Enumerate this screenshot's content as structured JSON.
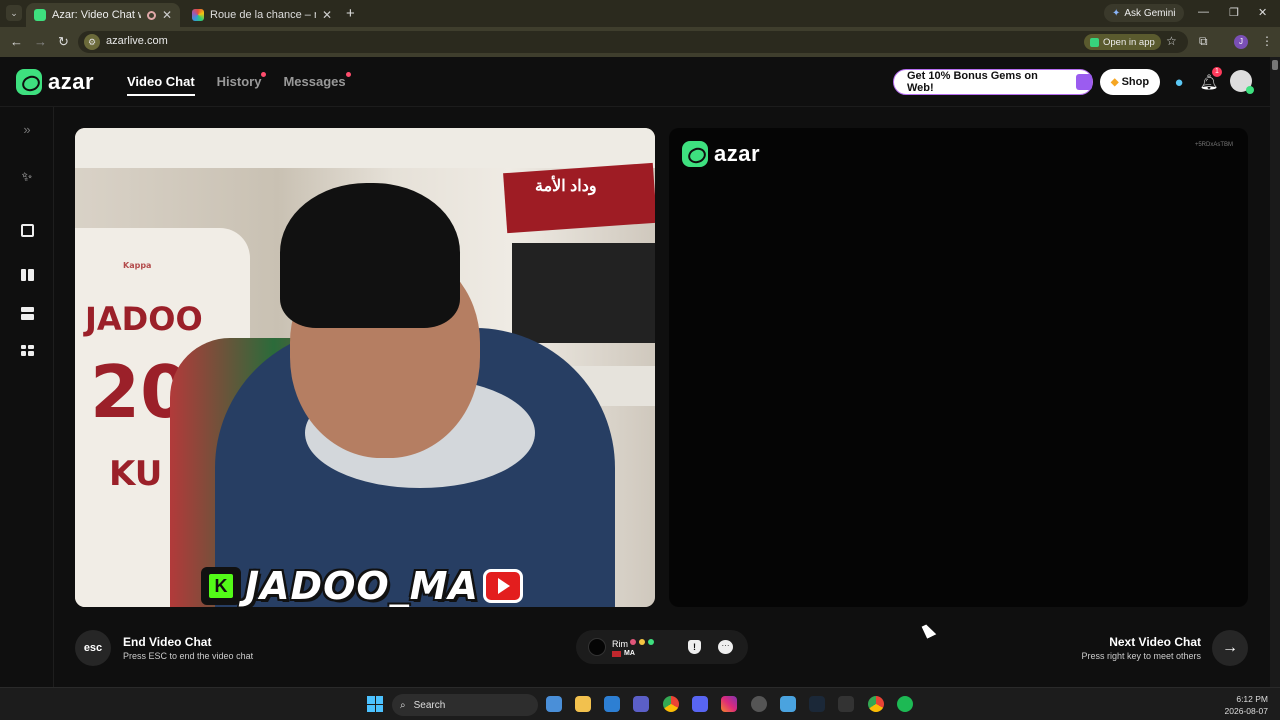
{
  "browser": {
    "tabs": [
      {
        "title": "Azar: Video Chat with New",
        "favicon": "azar-icon",
        "active": true
      },
      {
        "title": "Roue de la chance – roue aléat",
        "favicon": "wheel-icon",
        "active": false
      }
    ],
    "ask_gemini": "Ask Gemini",
    "url": "azarlive.com",
    "open_in_app": "Open in app"
  },
  "app": {
    "logo": "azar",
    "nav": [
      {
        "label": "Video Chat",
        "active": true
      },
      {
        "label": "History",
        "has_dot": true
      },
      {
        "label": "Messages",
        "has_dot": true
      }
    ],
    "promo": "Get 10% Bonus Gems on Web!",
    "shop": "Shop",
    "notification_count": "1"
  },
  "video_left": {
    "jersey_name": "JADOO",
    "jersey_number": "20",
    "jersey_letters": "KU",
    "jersey_brand": "Kappa",
    "scarf_text": "وداد الأمة",
    "overlay_k": "K",
    "overlay_name": "JADOO_MA"
  },
  "video_right": {
    "logo": "azar",
    "session_id": "+5RDxAsTBM"
  },
  "controls": {
    "esc_label": "esc",
    "end_title": "End Video Chat",
    "end_sub": "Press ESC to end the video chat",
    "partner_name": "Rim",
    "partner_country": "MA",
    "next_title": "Next Video Chat",
    "next_sub": "Press right key to meet others"
  },
  "taskbar": {
    "search": "Search",
    "time": "6:12 PM",
    "date": "2026-08-07"
  }
}
